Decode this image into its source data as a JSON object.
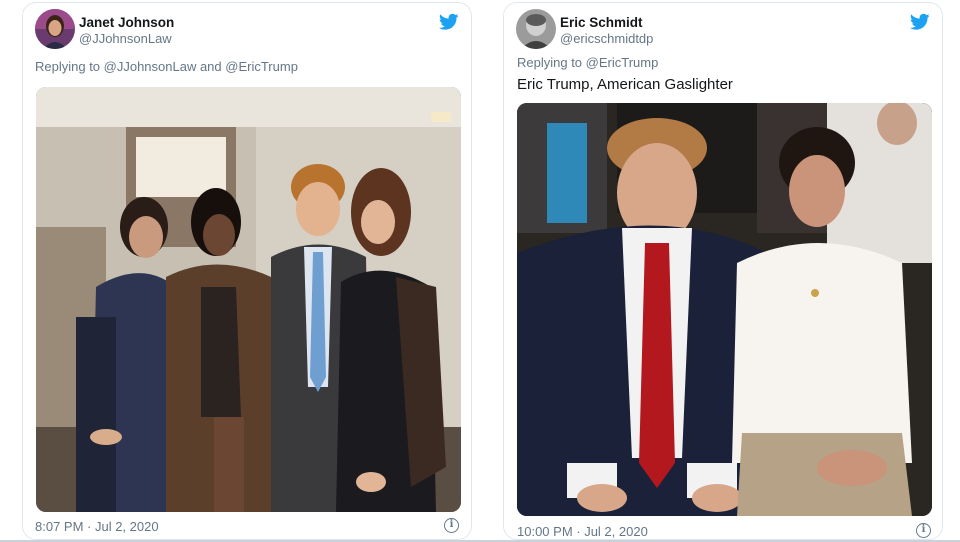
{
  "tweets": [
    {
      "display_name": "Janet Johnson",
      "handle": "@JJohnsonLaw",
      "reply_line": "Replying to @JJohnsonLaw and @EricTrump",
      "text": "",
      "timestamp": "8:07 PM · Jul 2, 2020",
      "info_glyph": "i",
      "icons": {
        "platform": "twitter-bird-icon",
        "info": "info-icon"
      }
    },
    {
      "display_name": "Eric Schmidt",
      "handle": "@ericschmidtdp",
      "reply_line": "Replying to @EricTrump",
      "text": "Eric Trump, American Gaslighter",
      "timestamp": "10:00 PM · Jul 2, 2020",
      "info_glyph": "i",
      "icons": {
        "platform": "twitter-bird-icon",
        "info": "info-icon"
      }
    }
  ],
  "colors": {
    "twitter_blue": "#1da1f2",
    "secondary_text": "#657786",
    "border": "#e1e8ed"
  }
}
